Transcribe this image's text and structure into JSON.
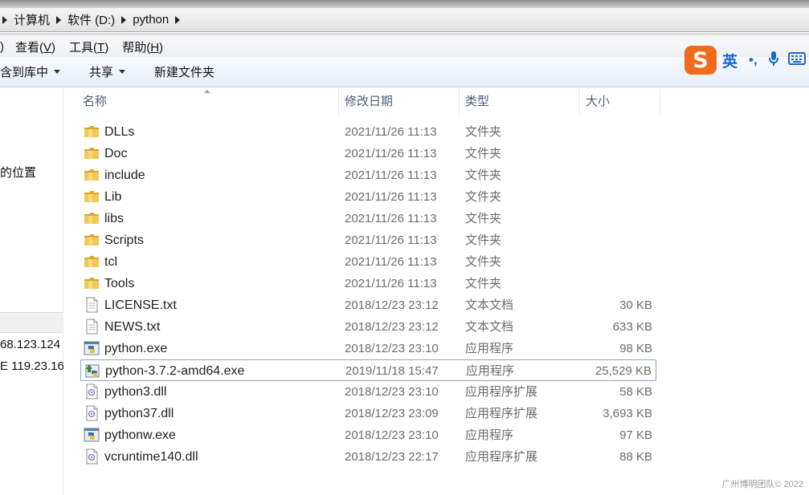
{
  "address": {
    "crumbs": [
      "计算机",
      "软件 (D:)",
      "python"
    ]
  },
  "menu": {
    "items": [
      {
        "label": ")",
        "key": ""
      },
      {
        "label": "查看(",
        "key": "V",
        "suffix": ")"
      },
      {
        "label": "工具(",
        "key": "T",
        "suffix": ")"
      },
      {
        "label": "帮助(",
        "key": "H",
        "suffix": ")"
      }
    ]
  },
  "toolbar": {
    "include_label": "含到库中",
    "share_label": "共享",
    "new_folder_label": "新建文件夹"
  },
  "ime": {
    "logo": "S",
    "lang": "英",
    "punct": "•,"
  },
  "nav": {
    "location_text": "的位置",
    "ip1": "68.123.124",
    "ip2": "E 119.23.16"
  },
  "columns": {
    "name": "名称",
    "modified": "修改日期",
    "type": "类型",
    "size": "大小"
  },
  "files": [
    {
      "name": "DLLs",
      "date": "2021/11/26 11:13",
      "type": "文件夹",
      "size": "",
      "icon": "folder-icon"
    },
    {
      "name": "Doc",
      "date": "2021/11/26 11:13",
      "type": "文件夹",
      "size": "",
      "icon": "folder-icon"
    },
    {
      "name": "include",
      "date": "2021/11/26 11:13",
      "type": "文件夹",
      "size": "",
      "icon": "folder-icon"
    },
    {
      "name": "Lib",
      "date": "2021/11/26 11:13",
      "type": "文件夹",
      "size": "",
      "icon": "folder-icon"
    },
    {
      "name": "libs",
      "date": "2021/11/26 11:13",
      "type": "文件夹",
      "size": "",
      "icon": "folder-icon"
    },
    {
      "name": "Scripts",
      "date": "2021/11/26 11:13",
      "type": "文件夹",
      "size": "",
      "icon": "folder-icon"
    },
    {
      "name": "tcl",
      "date": "2021/11/26 11:13",
      "type": "文件夹",
      "size": "",
      "icon": "folder-icon"
    },
    {
      "name": "Tools",
      "date": "2021/11/26 11:13",
      "type": "文件夹",
      "size": "",
      "icon": "folder-icon"
    },
    {
      "name": "LICENSE.txt",
      "date": "2018/12/23 23:12",
      "type": "文本文档",
      "size": "30 KB",
      "icon": "text-file-icon"
    },
    {
      "name": "NEWS.txt",
      "date": "2018/12/23 23:12",
      "type": "文本文档",
      "size": "633 KB",
      "icon": "text-file-icon"
    },
    {
      "name": "python.exe",
      "date": "2018/12/23 23:10",
      "type": "应用程序",
      "size": "98 KB",
      "icon": "python-exe-icon"
    },
    {
      "name": "python-3.7.2-amd64.exe",
      "date": "2019/11/18 15:47",
      "type": "应用程序",
      "size": "25,529 KB",
      "icon": "installer-icon",
      "selected": true
    },
    {
      "name": "python3.dll",
      "date": "2018/12/23 23:10",
      "type": "应用程序扩展",
      "size": "58 KB",
      "icon": "dll-icon"
    },
    {
      "name": "python37.dll",
      "date": "2018/12/23 23:09",
      "type": "应用程序扩展",
      "size": "3,693 KB",
      "icon": "dll-icon"
    },
    {
      "name": "pythonw.exe",
      "date": "2018/12/23 23:10",
      "type": "应用程序",
      "size": "97 KB",
      "icon": "python-exe-icon"
    },
    {
      "name": "vcruntime140.dll",
      "date": "2018/12/23 22:17",
      "type": "应用程序扩展",
      "size": "88 KB",
      "icon": "dll-icon"
    }
  ],
  "watermark": "广州博明团队© 2022",
  "colors": {
    "folder": "#e8b840",
    "selection_border": "#8aa5c3",
    "ime_orange": "#f26a1b",
    "ime_blue": "#1769d2"
  }
}
